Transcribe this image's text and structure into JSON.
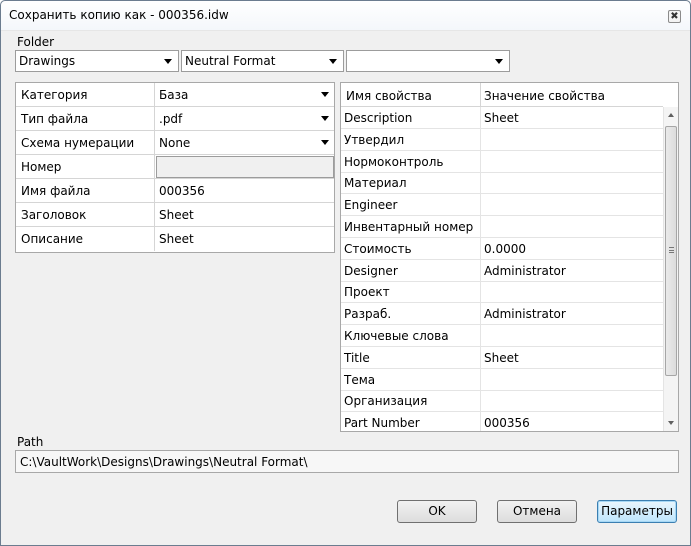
{
  "window": {
    "title": "Сохранить копию как - 000356.idw",
    "close_glyph": "✖"
  },
  "folder": {
    "label": "Folder",
    "combo1": "Drawings",
    "combo2": "Neutral Format",
    "combo3": ""
  },
  "left_grid": [
    {
      "key": "Категория",
      "value": "База",
      "type": "combo"
    },
    {
      "key": "Тип файла",
      "value": ".pdf",
      "type": "combo"
    },
    {
      "key": "Схема нумерации",
      "value": "None",
      "type": "combo"
    },
    {
      "key": "Номер",
      "value": "",
      "type": "disabled"
    },
    {
      "key": "Имя файла",
      "value": "000356",
      "type": "text"
    },
    {
      "key": "Заголовок",
      "value": "Sheet",
      "type": "text"
    },
    {
      "key": "Описание",
      "value": "Sheet",
      "type": "text"
    }
  ],
  "properties": {
    "header": {
      "name": "Имя свойства",
      "value": "Значение свойства"
    },
    "rows": [
      {
        "name": "Description",
        "value": "Sheet"
      },
      {
        "name": "Утвердил",
        "value": ""
      },
      {
        "name": "Нормоконтроль",
        "value": ""
      },
      {
        "name": "Материал",
        "value": ""
      },
      {
        "name": "Engineer",
        "value": ""
      },
      {
        "name": "Инвентарный номер",
        "value": ""
      },
      {
        "name": "Стоимость",
        "value": "0.0000"
      },
      {
        "name": "Designer",
        "value": "Administrator"
      },
      {
        "name": "Проект",
        "value": ""
      },
      {
        "name": "Разраб.",
        "value": "Administrator"
      },
      {
        "name": "Ключевые слова",
        "value": ""
      },
      {
        "name": "Title",
        "value": "Sheet"
      },
      {
        "name": "Тема",
        "value": ""
      },
      {
        "name": "Организация",
        "value": ""
      },
      {
        "name": "Part Number",
        "value": "000356"
      }
    ]
  },
  "path": {
    "label": "Path",
    "value": "C:\\VaultWork\\Designs\\Drawings\\Neutral Format\\"
  },
  "buttons": {
    "ok": "OK",
    "cancel": "Отмена",
    "options": "Параметры"
  }
}
